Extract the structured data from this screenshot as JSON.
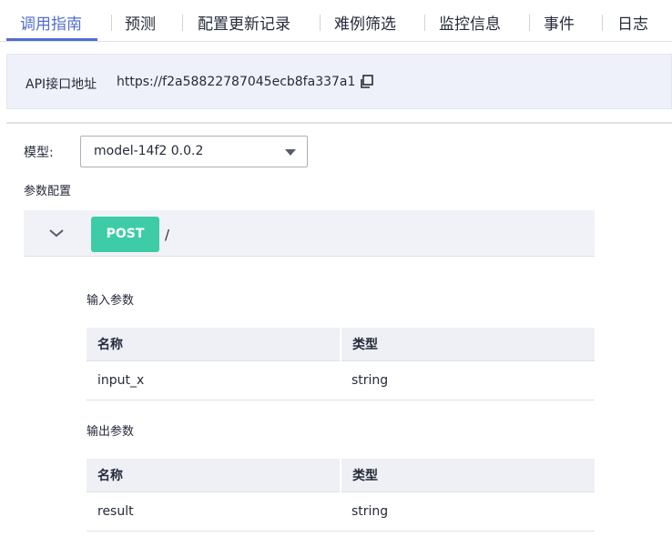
{
  "tabs": [
    {
      "label": "调用指南",
      "active": true
    },
    {
      "label": "预测"
    },
    {
      "label": "配置更新记录"
    },
    {
      "label": "难例筛选"
    },
    {
      "label": "监控信息"
    },
    {
      "label": "事件"
    },
    {
      "label": "日志"
    }
  ],
  "api": {
    "label": "API接口地址",
    "url": "https://f2a58822787045ecb8fa337a1",
    "copy_icon": "copy-icon"
  },
  "model": {
    "label": "模型:",
    "selected": "model-14f2 0.0.2"
  },
  "params": {
    "title": "参数配置",
    "method": "POST",
    "path": "/",
    "input": {
      "title": "输入参数",
      "headers": [
        "名称",
        "类型"
      ],
      "rows": [
        [
          "input_x",
          "string"
        ]
      ]
    },
    "output": {
      "title": "输出参数",
      "headers": [
        "名称",
        "类型"
      ],
      "rows": [
        [
          "result",
          "string"
        ]
      ]
    }
  },
  "colors": {
    "accent": "#526ecc",
    "post_badge": "#3dcca6",
    "api_box_bg": "#eef1f9"
  }
}
